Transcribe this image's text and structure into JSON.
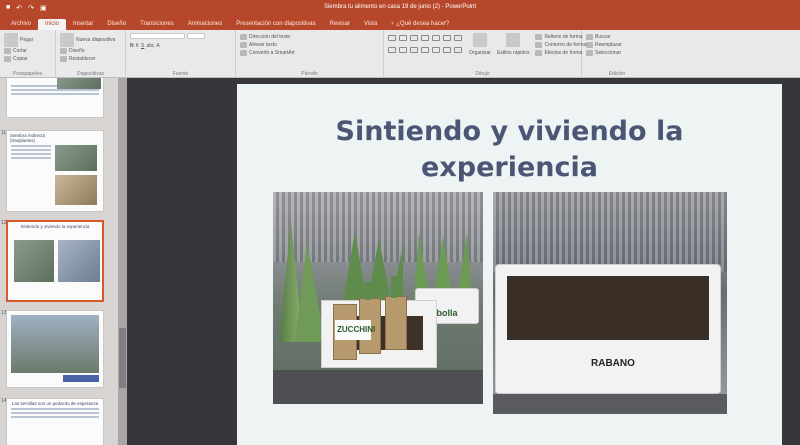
{
  "window": {
    "title": "Siembra tu alimento en casa 19 de junio (2) - PowerPoint"
  },
  "tabs": [
    {
      "label": "Archivo"
    },
    {
      "label": "Inicio",
      "active": true
    },
    {
      "label": "Insertar"
    },
    {
      "label": "Diseño"
    },
    {
      "label": "Transiciones"
    },
    {
      "label": "Animaciones"
    },
    {
      "label": "Presentación con diapositivas"
    },
    {
      "label": "Revisar"
    },
    {
      "label": "Vista"
    }
  ],
  "tell_me": "¿Qué desea hacer?",
  "ribbon": {
    "clipboard": {
      "label": "Portapapeles",
      "paste": "Pegar",
      "cut": "Cortar",
      "copy": "Copiar",
      "format": "Copiar formato"
    },
    "slides": {
      "label": "Diapositivas",
      "new_slide": "Nueva diapositiva",
      "layout": "Diseño",
      "reset": "Restablecer",
      "section": "Sección"
    },
    "font": {
      "label": "Fuente"
    },
    "paragraph": {
      "label": "Párrafo",
      "direction": "Dirección del texto",
      "align": "Alinear texto",
      "smartart": "Convertir a SmartArt"
    },
    "drawing": {
      "label": "Dibujo",
      "arrange": "Organizar",
      "quick_styles": "Estilos rápidos",
      "fill": "Relleno de forma",
      "outline": "Contorno de forma",
      "effects": "Efectos de forma"
    },
    "editing": {
      "label": "Edición",
      "find": "Buscar",
      "replace": "Reemplazar",
      "select": "Seleccionar"
    }
  },
  "thumbnails": [
    {
      "num": "10",
      "title": ""
    },
    {
      "num": "11",
      "title": "Siembra indirecta (trasplantes)"
    },
    {
      "num": "12",
      "title": "Sintiendo y viviendo la experiencia"
    },
    {
      "num": "13",
      "title": ""
    },
    {
      "num": "14",
      "title": "Las semillas son un pedacito de esperanza"
    }
  ],
  "slide": {
    "title_line1": "Sintiendo y viviendo la",
    "title_line2": "experiencia",
    "left_photo": {
      "label_zucchini": "ZUCCHINI",
      "label_cebolla": "Cebolla"
    },
    "right_photo": {
      "label_rabano": "RABANO"
    }
  }
}
